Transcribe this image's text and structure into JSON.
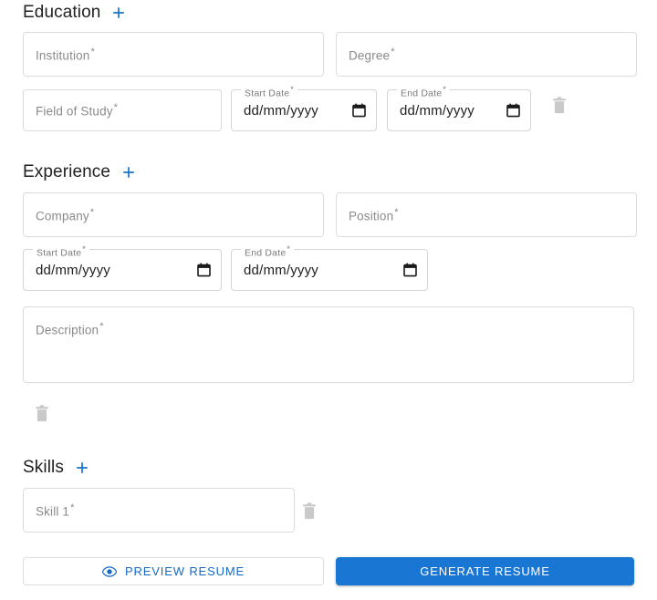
{
  "sections": {
    "education": {
      "title": "Education",
      "add_icon": "plus-icon",
      "add_label": "+",
      "fields": {
        "institution": {
          "placeholder": "Institution",
          "required_mark": "*"
        },
        "degree": {
          "placeholder": "Degree",
          "required_mark": "*"
        },
        "field_of_study": {
          "placeholder": "Field of Study",
          "required_mark": "*"
        },
        "start_date": {
          "label": "Start Date",
          "required_mark": "*",
          "value": "dd/mm/yyyy",
          "icon": "calendar-icon"
        },
        "end_date": {
          "label": "End Date",
          "required_mark": "*",
          "value": "dd/mm/yyyy",
          "icon": "calendar-icon"
        }
      },
      "delete_icon": "trash-icon"
    },
    "experience": {
      "title": "Experience",
      "add_icon": "plus-icon",
      "add_label": "+",
      "fields": {
        "company": {
          "placeholder": "Company",
          "required_mark": "*"
        },
        "position": {
          "placeholder": "Position",
          "required_mark": "*"
        },
        "start_date": {
          "label": "Start Date",
          "required_mark": "*",
          "value": "dd/mm/yyyy",
          "icon": "calendar-icon"
        },
        "end_date": {
          "label": "End Date",
          "required_mark": "*",
          "value": "dd/mm/yyyy",
          "icon": "calendar-icon"
        },
        "description": {
          "placeholder": "Description",
          "required_mark": "*"
        }
      },
      "delete_icon": "trash-icon"
    },
    "skills": {
      "title": "Skills",
      "add_icon": "plus-icon",
      "add_label": "+",
      "fields": {
        "skill_1": {
          "placeholder": "Skill 1",
          "required_mark": "*"
        }
      },
      "delete_icon": "trash-icon"
    }
  },
  "actions": {
    "preview": {
      "label": "PREVIEW RESUME",
      "icon": "eye-icon"
    },
    "generate": {
      "label": "GENERATE RESUME"
    }
  },
  "colors": {
    "accent_blue": "#1976d2",
    "link_blue": "#1769c4",
    "border_gray": "#dcdcdc",
    "placeholder_gray": "#8a8a8a",
    "trash_gray": "#c7c7c7",
    "text_dark": "#212121"
  }
}
